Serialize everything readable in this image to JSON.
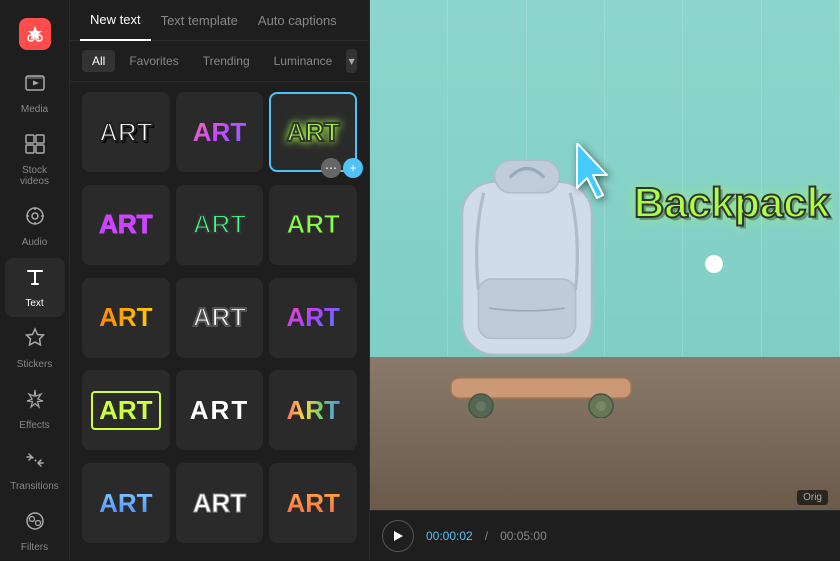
{
  "app": {
    "logo": "✂"
  },
  "sidebar": {
    "items": [
      {
        "id": "media",
        "label": "Media",
        "icon": "🎬"
      },
      {
        "id": "stock",
        "label": "Stock videos",
        "icon": "⊞"
      },
      {
        "id": "audio",
        "label": "Audio",
        "icon": "◎"
      },
      {
        "id": "text",
        "label": "Text",
        "icon": "T",
        "active": true
      },
      {
        "id": "stickers",
        "label": "Stickers",
        "icon": "⭐"
      },
      {
        "id": "effects",
        "label": "Effects",
        "icon": "✦"
      },
      {
        "id": "transitions",
        "label": "Transitions",
        "icon": "⇄"
      },
      {
        "id": "filters",
        "label": "Filters",
        "icon": "◈"
      }
    ]
  },
  "panel": {
    "tabs": [
      {
        "id": "new-text",
        "label": "New text",
        "active": true
      },
      {
        "id": "text-template",
        "label": "Text template"
      },
      {
        "id": "auto-captions",
        "label": "Auto captions"
      }
    ],
    "filter_tabs": [
      {
        "id": "all",
        "label": "All",
        "active": true
      },
      {
        "id": "favorites",
        "label": "Favorites"
      },
      {
        "id": "trending",
        "label": "Trending"
      },
      {
        "id": "luminance",
        "label": "Luminance"
      }
    ],
    "styles": [
      {
        "id": 1,
        "label": "ART",
        "style_class": "art-style-1"
      },
      {
        "id": 2,
        "label": "ART",
        "style_class": "art-style-2"
      },
      {
        "id": 3,
        "label": "ART",
        "style_class": "art-style-3",
        "selected": true
      },
      {
        "id": 4,
        "label": "ART",
        "style_class": "art-style-4"
      },
      {
        "id": 5,
        "label": "ART",
        "style_class": "art-style-5"
      },
      {
        "id": 6,
        "label": "ART",
        "style_class": "art-style-6"
      },
      {
        "id": 7,
        "label": "ART",
        "style_class": "art-style-7"
      },
      {
        "id": 8,
        "label": "ART",
        "style_class": "art-style-8"
      },
      {
        "id": 9,
        "label": "ART",
        "style_class": "art-style-9"
      },
      {
        "id": 10,
        "label": "ART",
        "style_class": "art-style-10"
      },
      {
        "id": 11,
        "label": "ART",
        "style_class": "art-style-11"
      },
      {
        "id": 12,
        "label": "ART",
        "style_class": "art-style-12"
      },
      {
        "id": 13,
        "label": "ART",
        "style_class": "art-style-13"
      },
      {
        "id": 14,
        "label": "ART",
        "style_class": "art-style-14"
      },
      {
        "id": 15,
        "label": "ART",
        "style_class": "art-style-15"
      }
    ]
  },
  "preview": {
    "overlay_text": "Backpack",
    "time_current": "00:00:02",
    "time_total": "00:05:00",
    "orig_label": "Orig"
  }
}
